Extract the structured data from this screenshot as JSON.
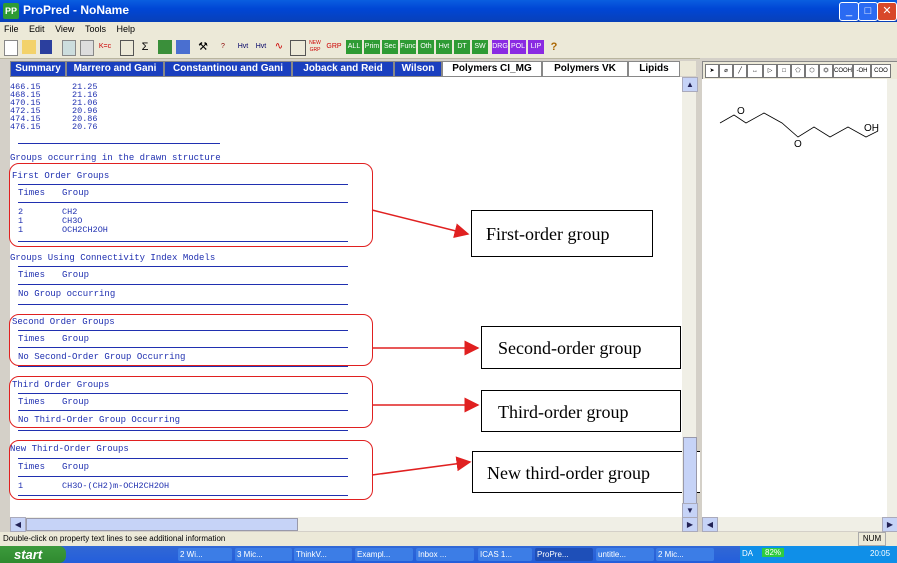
{
  "window": {
    "title": "ProPred - NoName",
    "app_icon": "ProPred"
  },
  "menu": [
    "File",
    "Edit",
    "View",
    "Tools",
    "Help"
  ],
  "toolbar": {
    "buttons": [
      "new-icon",
      "open-icon",
      "save-icon",
      "copy-icon",
      "paste-icon",
      "K=c",
      "grid-icon",
      "sigma-icon",
      "table-icon",
      "chart-icon",
      "tools-icon",
      "help-icon",
      "Hvt",
      "Hvt",
      "curve-icon",
      "graph-icon",
      "NEW GRP",
      "GRP",
      "ALL",
      "Prim",
      "Sec",
      "Func",
      "Oth",
      "Hvt",
      "DT",
      "SW",
      "DRG",
      "POL",
      "LIP",
      "?"
    ]
  },
  "tabs": [
    "Summary",
    "Marrero and Gani",
    "Constantinou and Gani",
    "Joback and Reid",
    "Wilson",
    "Polymers CI_MG",
    "Polymers VK",
    "Lipids"
  ],
  "data_rows": [
    {
      "t": "466.15",
      "v": "21.25"
    },
    {
      "t": "468.15",
      "v": "21.16"
    },
    {
      "t": "470.15",
      "v": "21.06"
    },
    {
      "t": "472.15",
      "v": "20.96"
    },
    {
      "t": "474.15",
      "v": "20.86"
    },
    {
      "t": "476.15",
      "v": "20.76"
    }
  ],
  "groups_heading": "Groups occurring in the drawn structure",
  "col_times": "Times",
  "col_group": "Group",
  "first_order": {
    "title": "First Order Groups",
    "rows": [
      {
        "times": "2",
        "group": "CH2"
      },
      {
        "times": "1",
        "group": "CH3O"
      },
      {
        "times": "1",
        "group": "OCH2CH2OH"
      }
    ]
  },
  "connectivity": {
    "title": "Groups Using Connectivity Index Models",
    "none": "No Group occurring"
  },
  "second_order": {
    "title": "Second Order Groups",
    "none": "No Second-Order Group Occurring"
  },
  "third_order": {
    "title": "Third Order Groups",
    "none": "No Third-Order Group Occurring"
  },
  "new_third_order": {
    "title": "New Third-Order Groups",
    "rows": [
      {
        "times": "1",
        "group": "CH3O-(CH2)m-OCH2CH2OH"
      }
    ]
  },
  "annotations": {
    "first": "First-order group",
    "second": "Second-order group",
    "third": "Third-order group",
    "new_third": "New third-order group"
  },
  "structure": {
    "atom_o1": "O",
    "atom_o2": "O",
    "atom_oh": "OH"
  },
  "draw_tools": [
    "pointer-icon",
    "eraser-icon",
    "line-icon",
    "dimension-icon",
    "play-icon",
    "square-icon",
    "pentagon-icon",
    "hexagon-icon",
    "benzene-icon",
    "COOH",
    "-OH",
    "COO"
  ],
  "status": {
    "message": "Double-click on property text lines to see additional information",
    "num": "NUM"
  },
  "taskbar": {
    "start": "start",
    "tasks": [
      "2 Wi...",
      "3 Mic...",
      "ThinkV...",
      "Exampl...",
      "Inbox ...",
      "ICAS 1...",
      "ProPre...",
      "untitle...",
      "2 Mic..."
    ],
    "lang": "DA",
    "battery": "82%",
    "clock": "20:05"
  },
  "colors": {
    "annotation_red": "#e02020",
    "text_blue": "#2030b0",
    "tab_blue": "#1a3fbf"
  }
}
